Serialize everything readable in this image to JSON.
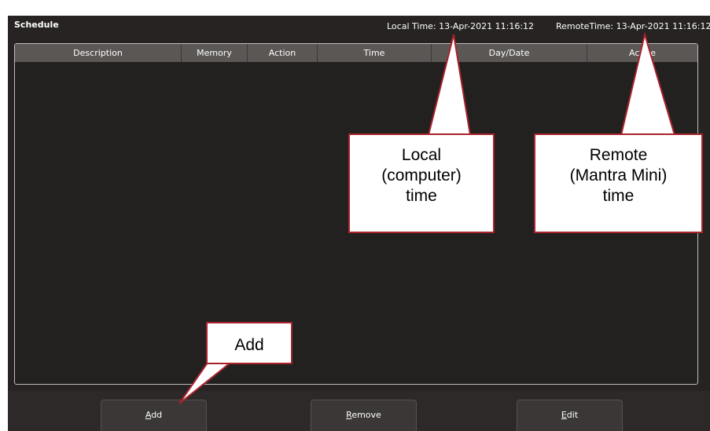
{
  "window": {
    "title": "Schedule",
    "local_time": "Local Time: 13-Apr-2021 11:16:12",
    "remote_time": "RemoteTime: 13-Apr-2021 11:16:12"
  },
  "table": {
    "columns": [
      "Description",
      "Memory",
      "Action",
      "Time",
      "Day/Date",
      "Active"
    ],
    "rows": []
  },
  "buttons": {
    "add": {
      "accel": "A",
      "rest": "dd"
    },
    "remove": {
      "accel": "R",
      "rest": "emove"
    },
    "edit": {
      "accel": "E",
      "rest": "dit"
    }
  },
  "callouts": {
    "local": [
      "Local",
      "(computer)",
      "time"
    ],
    "remote": [
      "Remote",
      "(Mantra Mini)",
      "time"
    ],
    "add": "Add"
  },
  "colors": {
    "panel": "#262322",
    "header": "#5b5755",
    "callout_border": "#a8232c"
  }
}
